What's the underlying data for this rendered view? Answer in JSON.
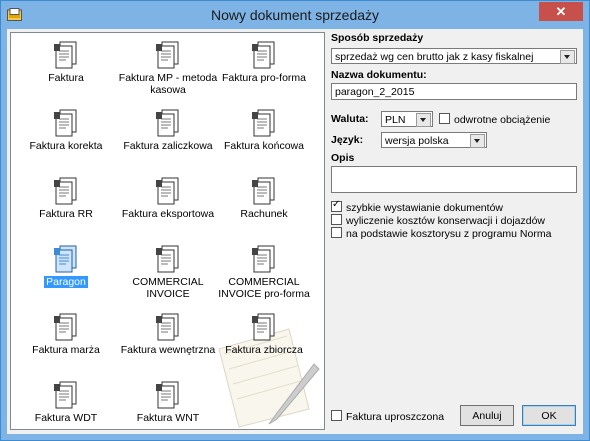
{
  "window": {
    "title": "Nowy dokument sprzedaży",
    "close_label": "✕"
  },
  "documents": [
    {
      "label": "Faktura"
    },
    {
      "label": "Faktura MP - metoda kasowa"
    },
    {
      "label": "Faktura pro-forma"
    },
    {
      "label": "Faktura korekta"
    },
    {
      "label": "Faktura zaliczkowa"
    },
    {
      "label": "Faktura końcowa"
    },
    {
      "label": "Faktura RR"
    },
    {
      "label": "Faktura eksportowa"
    },
    {
      "label": "Rachunek"
    },
    {
      "label": "Paragon",
      "selected": true
    },
    {
      "label": "COMMERCIAL INVOICE"
    },
    {
      "label": "COMMERCIAL INVOICE pro-forma"
    },
    {
      "label": "Faktura marża"
    },
    {
      "label": "Faktura wewnętrzna"
    },
    {
      "label": "Faktura zbiorcza"
    },
    {
      "label": "Faktura WDT"
    },
    {
      "label": "Faktura WNT"
    }
  ],
  "form": {
    "sposob_label": "Sposób sprzedaży",
    "sposob_value": "sprzedaż wg cen brutto jak z kasy fiskalnej",
    "nazwa_label": "Nazwa dokumentu:",
    "nazwa_value": "paragon_2_2015",
    "waluta_label": "Waluta:",
    "waluta_value": "PLN",
    "odwrotne_label": "odwrotne obciążenie",
    "jezyk_label": "Język:",
    "jezyk_value": "wersja polska",
    "opis_label": "Opis",
    "opis_value": "",
    "options": [
      {
        "label": "szybkie wystawianie dokumentów",
        "checked": true
      },
      {
        "label": "wyliczenie kosztów konserwacji i dojazdów",
        "checked": false
      },
      {
        "label": "na podstawie kosztorysu z programu Norma",
        "checked": false
      }
    ],
    "uproszczona_label": "Faktura uproszczona",
    "cancel_label": "Anuluj",
    "ok_label": "OK"
  }
}
